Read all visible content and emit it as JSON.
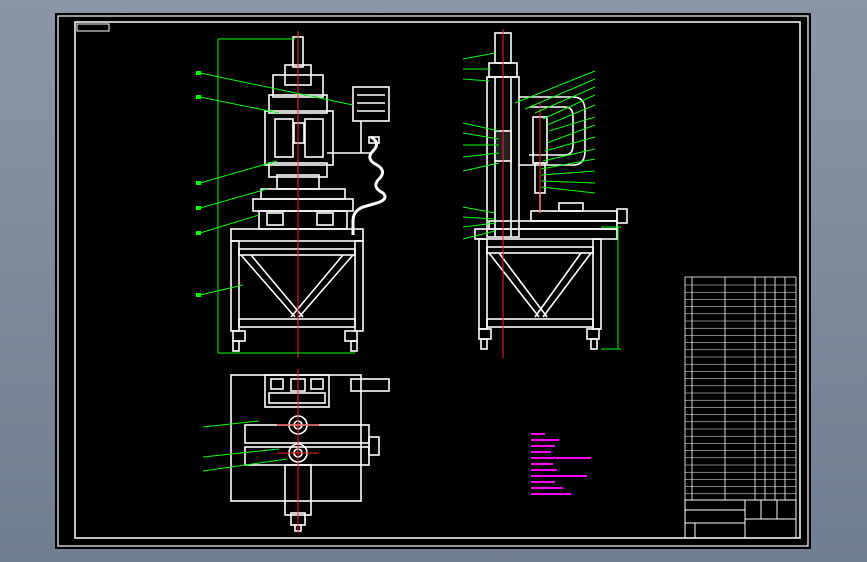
{
  "viewer": {
    "background_color": "#000000",
    "frame_color": "#ffffff",
    "line_color_main": "#ffffff",
    "centerline_color": "#ff2020",
    "leader_color": "#00ff00",
    "notes_color": "#ff00ff"
  },
  "views": {
    "front": "front-view",
    "side": "side-view",
    "top": "top-view"
  },
  "icons": {
    "control_box": "control-box-icon",
    "press_head": "press-head-icon",
    "worktable": "worktable-icon"
  }
}
